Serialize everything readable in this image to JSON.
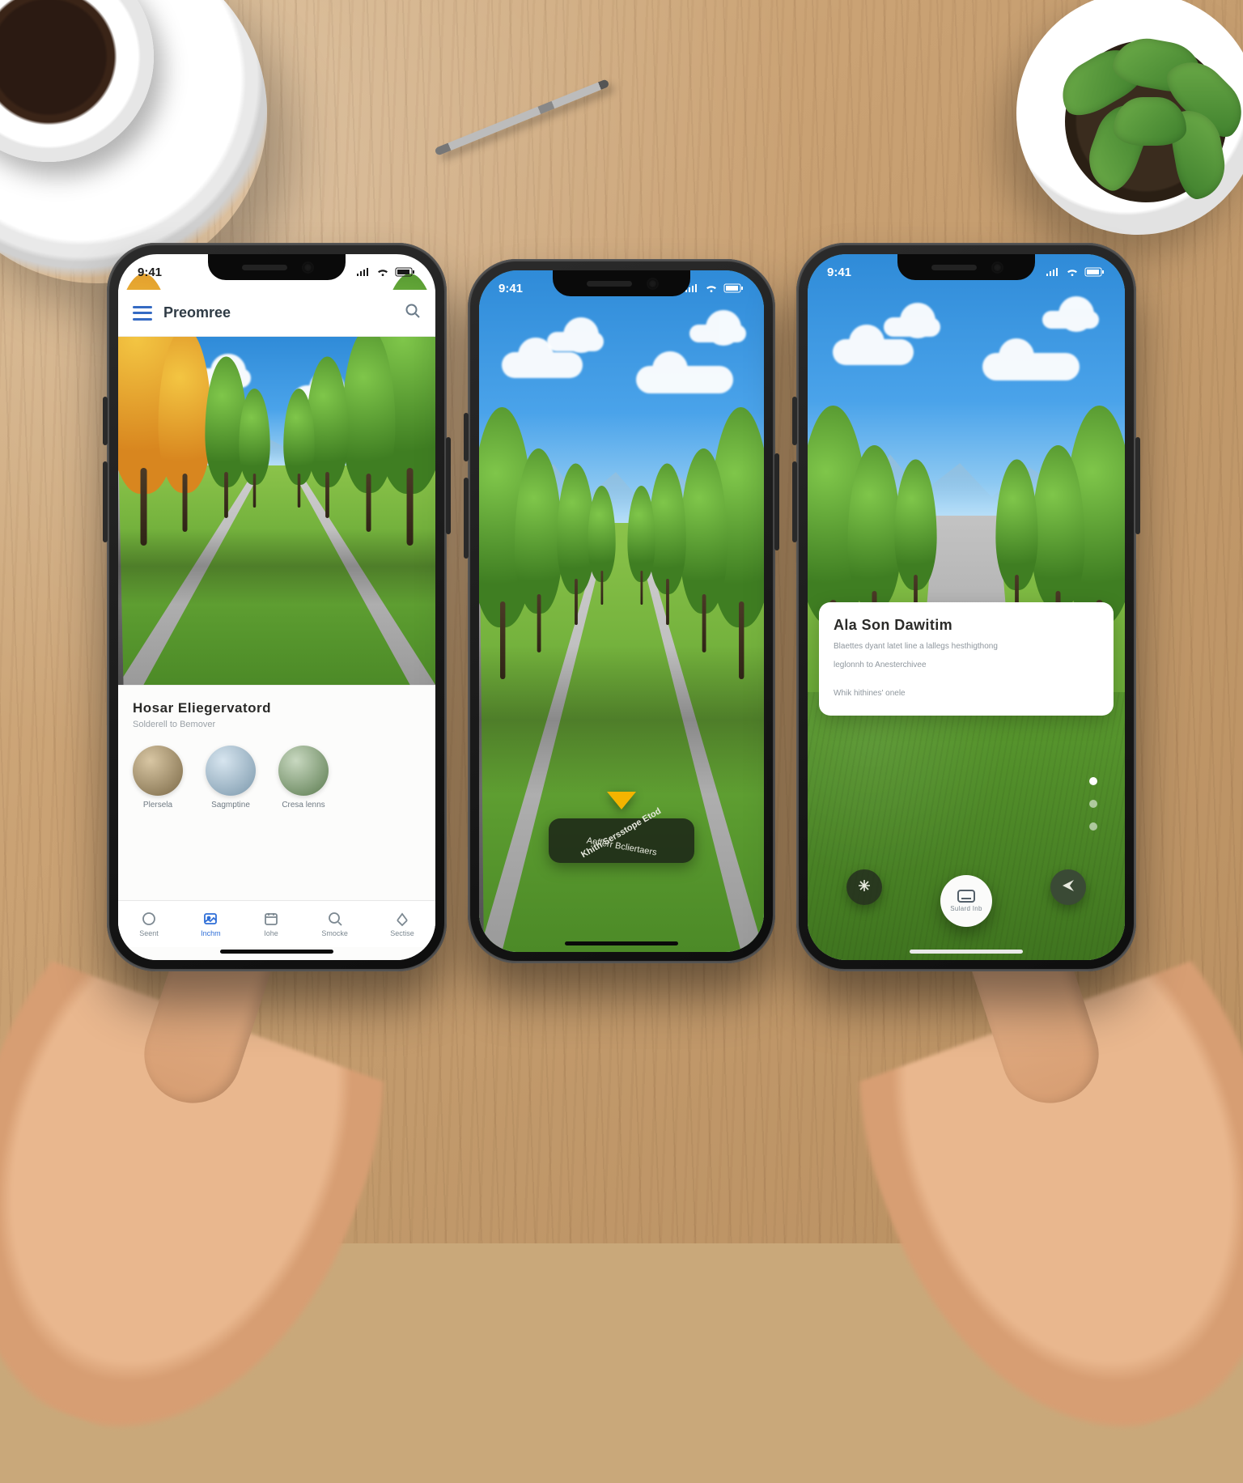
{
  "scene": {
    "props": [
      "coffee-cup",
      "succulent-plant",
      "pen",
      "two-hands-holding-phones"
    ]
  },
  "phones": {
    "left": {
      "status": {
        "time": "9:41"
      },
      "header": {
        "app_title": "Preomree",
        "menu_icon": "hamburger-icon",
        "action_icon": "search-icon"
      },
      "hero_caption": "tree-lined park avenue",
      "card": {
        "title": "Hosar Eliegervatord",
        "subtitle": "Solderell to Bemover"
      },
      "avatars": [
        {
          "label": "Plersela"
        },
        {
          "label": "Sagmptine"
        },
        {
          "label": "Cresa lenns"
        }
      ],
      "tabs": [
        {
          "label": "Seent",
          "icon": "circle-icon"
        },
        {
          "label": "Inchm",
          "icon": "image-icon"
        },
        {
          "label": "Iohe",
          "icon": "calendar-icon"
        },
        {
          "label": "Smocke",
          "icon": "search-icon"
        },
        {
          "label": "Sectise",
          "icon": "share-icon"
        }
      ],
      "active_tab_index": 1
    },
    "middle": {
      "status": {
        "time": "9:41"
      },
      "chip": {
        "line1": "Khith Sersstope Etod",
        "line2": "Aefferr Bcliertaers"
      },
      "arrow_icon": "navigation-arrow-down-icon"
    },
    "right": {
      "status": {
        "time": "9:41"
      },
      "card": {
        "title": "Ala Son Dawitim",
        "line1": "Blaettes dyant latet line a lallegs hesthigthong",
        "line2": "leglonnh to Anesterchivee",
        "meta": "Whik hithines' onele"
      },
      "pager": {
        "count": 3,
        "active_index": 0
      },
      "bottom": {
        "left_icon": "sparkle-icon",
        "main": {
          "icon": "card-icon",
          "label": "Sulard Inb"
        },
        "right_icon": "send-icon"
      }
    }
  }
}
